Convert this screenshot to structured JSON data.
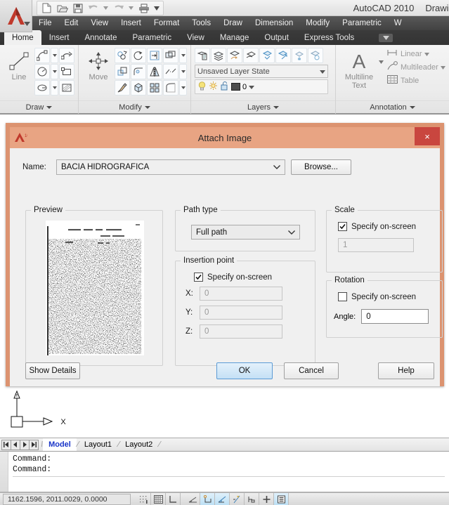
{
  "titlebar": {
    "app_title": "AutoCAD 2010",
    "document_title": "Drawing",
    "quick_access": [
      {
        "name": "new-icon",
        "label": "New"
      },
      {
        "name": "open-icon",
        "label": "Open"
      },
      {
        "name": "save-icon",
        "label": "Save"
      },
      {
        "name": "undo-icon",
        "label": "Undo"
      },
      {
        "name": "redo-icon",
        "label": "Redo"
      },
      {
        "name": "plot-icon",
        "label": "Plot"
      }
    ]
  },
  "menubar": {
    "items": [
      "File",
      "Edit",
      "View",
      "Insert",
      "Format",
      "Tools",
      "Draw",
      "Dimension",
      "Modify",
      "Parametric",
      "W"
    ]
  },
  "ribbon_tabs": {
    "items": [
      "Home",
      "Insert",
      "Annotate",
      "Parametric",
      "View",
      "Manage",
      "Output",
      "Express Tools"
    ],
    "active": "Home"
  },
  "ribbon": {
    "panels": [
      {
        "title": "Draw",
        "big_button": "Line"
      },
      {
        "title": "Modify",
        "big_button": "Move"
      },
      {
        "title": "Layers",
        "layer_state": "Unsaved Layer State",
        "current_layer": "0"
      },
      {
        "title": "Annotation",
        "big_button_line1": "Multiline",
        "big_button_line2": "Text",
        "items": [
          "Linear",
          "Multileader",
          "Table"
        ]
      }
    ]
  },
  "dialog": {
    "title": "Attach Image",
    "close_label": "×",
    "name_label": "Name:",
    "name_value": "BACIA HIDROGRÁFICA",
    "browse_label": "Browse...",
    "preview_legend": "Preview",
    "path_type": {
      "legend": "Path type",
      "value": "Full path"
    },
    "insertion_point": {
      "legend": "Insertion point",
      "specify_label": "Specify on-screen",
      "specify_checked": true,
      "fields": [
        {
          "label": "X:",
          "value": "0"
        },
        {
          "label": "Y:",
          "value": "0"
        },
        {
          "label": "Z:",
          "value": "0"
        }
      ]
    },
    "scale": {
      "legend": "Scale",
      "specify_label": "Specify on-screen",
      "specify_checked": true,
      "value": "1"
    },
    "rotation": {
      "legend": "Rotation",
      "specify_label": "Specify on-screen",
      "specify_checked": false,
      "angle_label": "Angle:",
      "angle_value": "0"
    },
    "buttons": {
      "show_details": "Show Details",
      "ok": "OK",
      "cancel": "Cancel",
      "help": "Help"
    }
  },
  "layout_tabs": {
    "items": [
      "Model",
      "Layout1",
      "Layout2"
    ],
    "active": "Model"
  },
  "command_line": {
    "lines": [
      "Command:",
      "Command:"
    ]
  },
  "statusbar": {
    "coordinates": "1162.1596, 2011.0029, 0.0000",
    "toggles": [
      "snap-icon",
      "grid-icon",
      "ortho-icon",
      "polar-icon",
      "osnap-icon",
      "3dosnap-icon",
      "otrack-icon",
      "ducs-icon",
      "dyn-icon",
      "lineweight-icon"
    ]
  },
  "colors": {
    "dialog_border": "#dc9370",
    "dialog_titlebar": "#e8a483",
    "close_button": "#c9463f",
    "ok_focus": "#5b9bd5",
    "active_tab_text": "#1a36c8"
  }
}
